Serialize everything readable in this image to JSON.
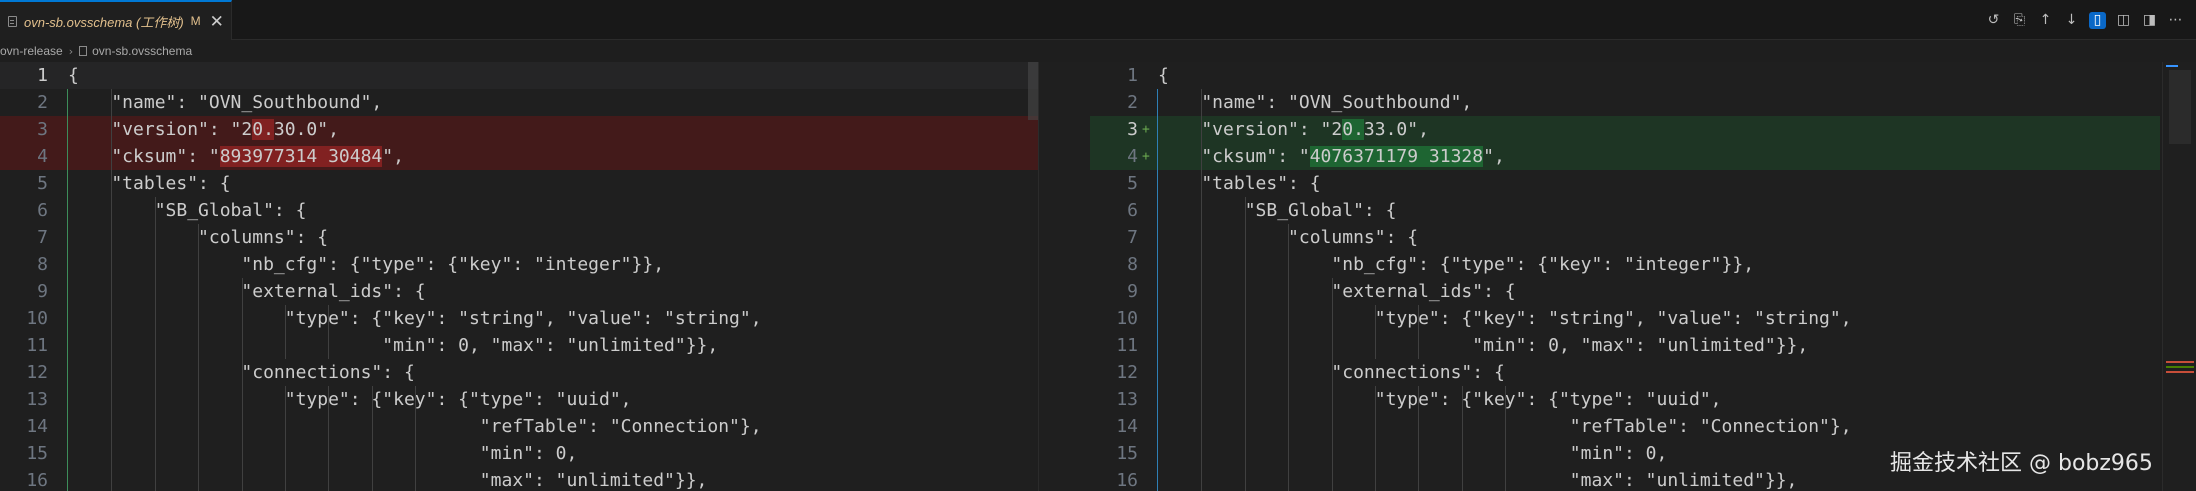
{
  "tab": {
    "title": "ovn-sb.ovsschema (工作树)",
    "modified": "M",
    "close": "✕"
  },
  "breadcrumb": {
    "folder": "ovn-release",
    "separator": "›",
    "file": "ovn-sb.ovsschema"
  },
  "toolbar": {
    "icons": [
      "history-icon",
      "open-file-icon",
      "arrow-up-icon",
      "arrow-down-icon",
      "inline-diff-icon",
      "book-icon",
      "split-editor-icon",
      "more-icon"
    ]
  },
  "left_pane": {
    "lines": [
      {
        "n": "1",
        "text": "{"
      },
      {
        "n": "2",
        "text": "    \"name\": \"OVN_Southbound\","
      },
      {
        "n": "3",
        "text": "    \"version\": \"20.30.0\","
      },
      {
        "n": "4",
        "text": "    \"cksum\": \"893977314 30484\","
      },
      {
        "n": "5",
        "text": "    \"tables\": {"
      },
      {
        "n": "6",
        "text": "        \"SB_Global\": {"
      },
      {
        "n": "7",
        "text": "            \"columns\": {"
      },
      {
        "n": "8",
        "text": "                \"nb_cfg\": {\"type\": {\"key\": \"integer\"}},"
      },
      {
        "n": "9",
        "text": "                \"external_ids\": {"
      },
      {
        "n": "10",
        "text": "                    \"type\": {\"key\": \"string\", \"value\": \"string\","
      },
      {
        "n": "11",
        "text": "                             \"min\": 0, \"max\": \"unlimited\"}},"
      },
      {
        "n": "12",
        "text": "                \"connections\": {"
      },
      {
        "n": "13",
        "text": "                    \"type\": {\"key\": {\"type\": \"uuid\","
      },
      {
        "n": "14",
        "text": "                                      \"refTable\": \"Connection\"},"
      },
      {
        "n": "15",
        "text": "                                      \"min\": 0,"
      },
      {
        "n": "16",
        "text": "                                      \"max\": \"unlimited\"}},"
      }
    ]
  },
  "right_pane": {
    "lines": [
      {
        "n": "1",
        "text": "{"
      },
      {
        "n": "2",
        "text": "    \"name\": \"OVN_Southbound\","
      },
      {
        "n": "3",
        "text": "    \"version\": \"20.33.0\","
      },
      {
        "n": "4",
        "text": "    \"cksum\": \"4076371179 31328\","
      },
      {
        "n": "5",
        "text": "    \"tables\": {"
      },
      {
        "n": "6",
        "text": "        \"SB_Global\": {"
      },
      {
        "n": "7",
        "text": "            \"columns\": {"
      },
      {
        "n": "8",
        "text": "                \"nb_cfg\": {\"type\": {\"key\": \"integer\"}},"
      },
      {
        "n": "9",
        "text": "                \"external_ids\": {"
      },
      {
        "n": "10",
        "text": "                    \"type\": {\"key\": \"string\", \"value\": \"string\","
      },
      {
        "n": "11",
        "text": "                             \"min\": 0, \"max\": \"unlimited\"}},"
      },
      {
        "n": "12",
        "text": "                \"connections\": {"
      },
      {
        "n": "13",
        "text": "                    \"type\": {\"key\": {\"type\": \"uuid\","
      },
      {
        "n": "14",
        "text": "                                      \"refTable\": \"Connection\"},"
      },
      {
        "n": "15",
        "text": "                                      \"min\": 0,"
      },
      {
        "n": "16",
        "text": "                                      \"max\": \"unlimited\"}},"
      }
    ],
    "insert_marker": "+"
  },
  "watermark": "掘金技术社区 @ bobz965",
  "colors": {
    "deleted_line": "#4b1818",
    "inserted_line": "#1c3a22",
    "accent": "#0078d4"
  }
}
